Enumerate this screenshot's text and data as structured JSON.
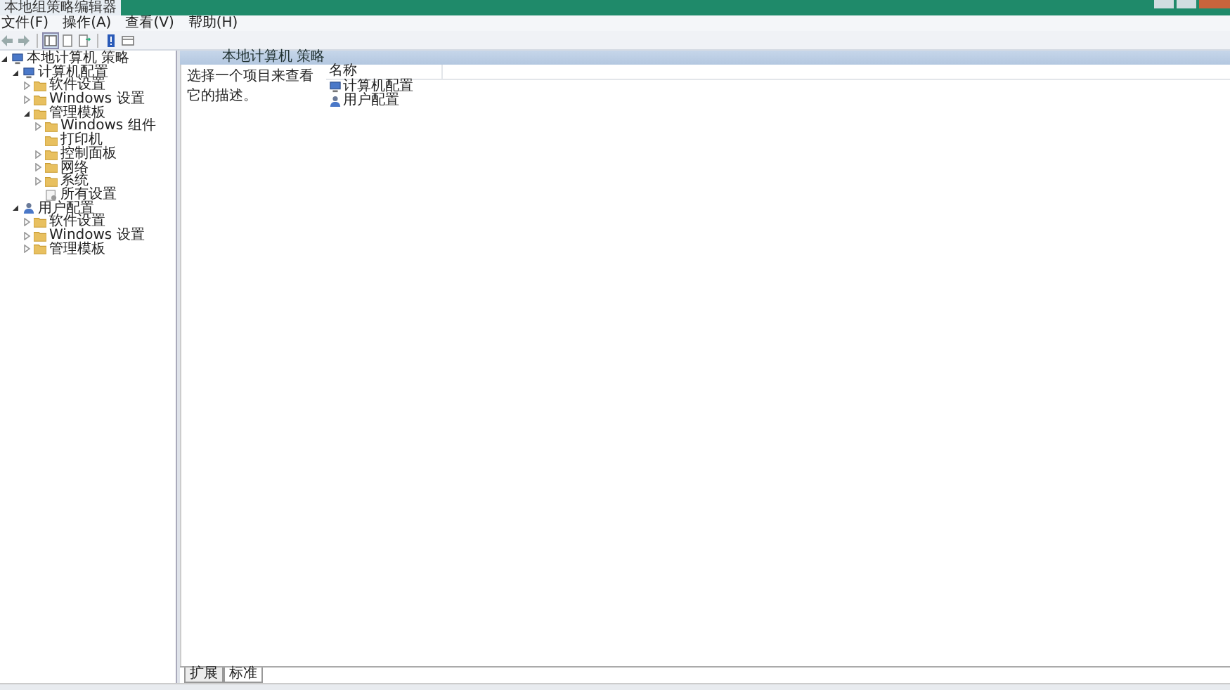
{
  "window": {
    "title": "本地组策略编辑器"
  },
  "menu": [
    "文件(F)",
    "操作(A)",
    "查看(V)",
    "帮助(H)"
  ],
  "toolbar": [
    {
      "kind": "back"
    },
    {
      "kind": "forward"
    },
    {
      "kind": "sep"
    },
    {
      "kind": "pane",
      "selected": true
    },
    {
      "kind": "doc"
    },
    {
      "kind": "export"
    },
    {
      "kind": "sep"
    },
    {
      "kind": "help"
    },
    {
      "kind": "view"
    }
  ],
  "tree": [
    {
      "label": "本地计算机 策略",
      "kind": "policy",
      "expanded": true,
      "children": [
        {
          "label": "计算机配置",
          "kind": "computer",
          "expanded": true,
          "children": [
            {
              "label": "软件设置",
              "kind": "folder",
              "expanded": false
            },
            {
              "label": "Windows 设置",
              "kind": "folder",
              "expanded": false
            },
            {
              "label": "管理模板",
              "kind": "folder",
              "expanded": true,
              "children": [
                {
                  "label": "Windows 组件",
                  "kind": "folder",
                  "expanded": false
                },
                {
                  "label": "打印机",
                  "kind": "leaf"
                },
                {
                  "label": "控制面板",
                  "kind": "folder",
                  "expanded": false
                },
                {
                  "label": "网络",
                  "kind": "folder",
                  "expanded": false
                },
                {
                  "label": "系统",
                  "kind": "folder",
                  "expanded": false
                },
                {
                  "label": "所有设置",
                  "kind": "settings"
                }
              ]
            }
          ]
        },
        {
          "label": "用户配置",
          "kind": "user",
          "expanded": true,
          "children": [
            {
              "label": "软件设置",
              "kind": "folder",
              "expanded": false
            },
            {
              "label": "Windows 设置",
              "kind": "folder",
              "expanded": false
            },
            {
              "label": "管理模板",
              "kind": "folder",
              "expanded": false
            }
          ]
        }
      ]
    }
  ],
  "details": {
    "header": "本地计算机 策略",
    "description": "选择一个项目来查看它的描述。",
    "columns": [
      "名称"
    ],
    "rows": [
      {
        "name": "计算机配置",
        "kind": "computer"
      },
      {
        "name": "用户配置",
        "kind": "user"
      }
    ]
  },
  "tabs": [
    {
      "label": "扩展",
      "selected": false
    },
    {
      "label": "标准",
      "selected": true
    }
  ]
}
